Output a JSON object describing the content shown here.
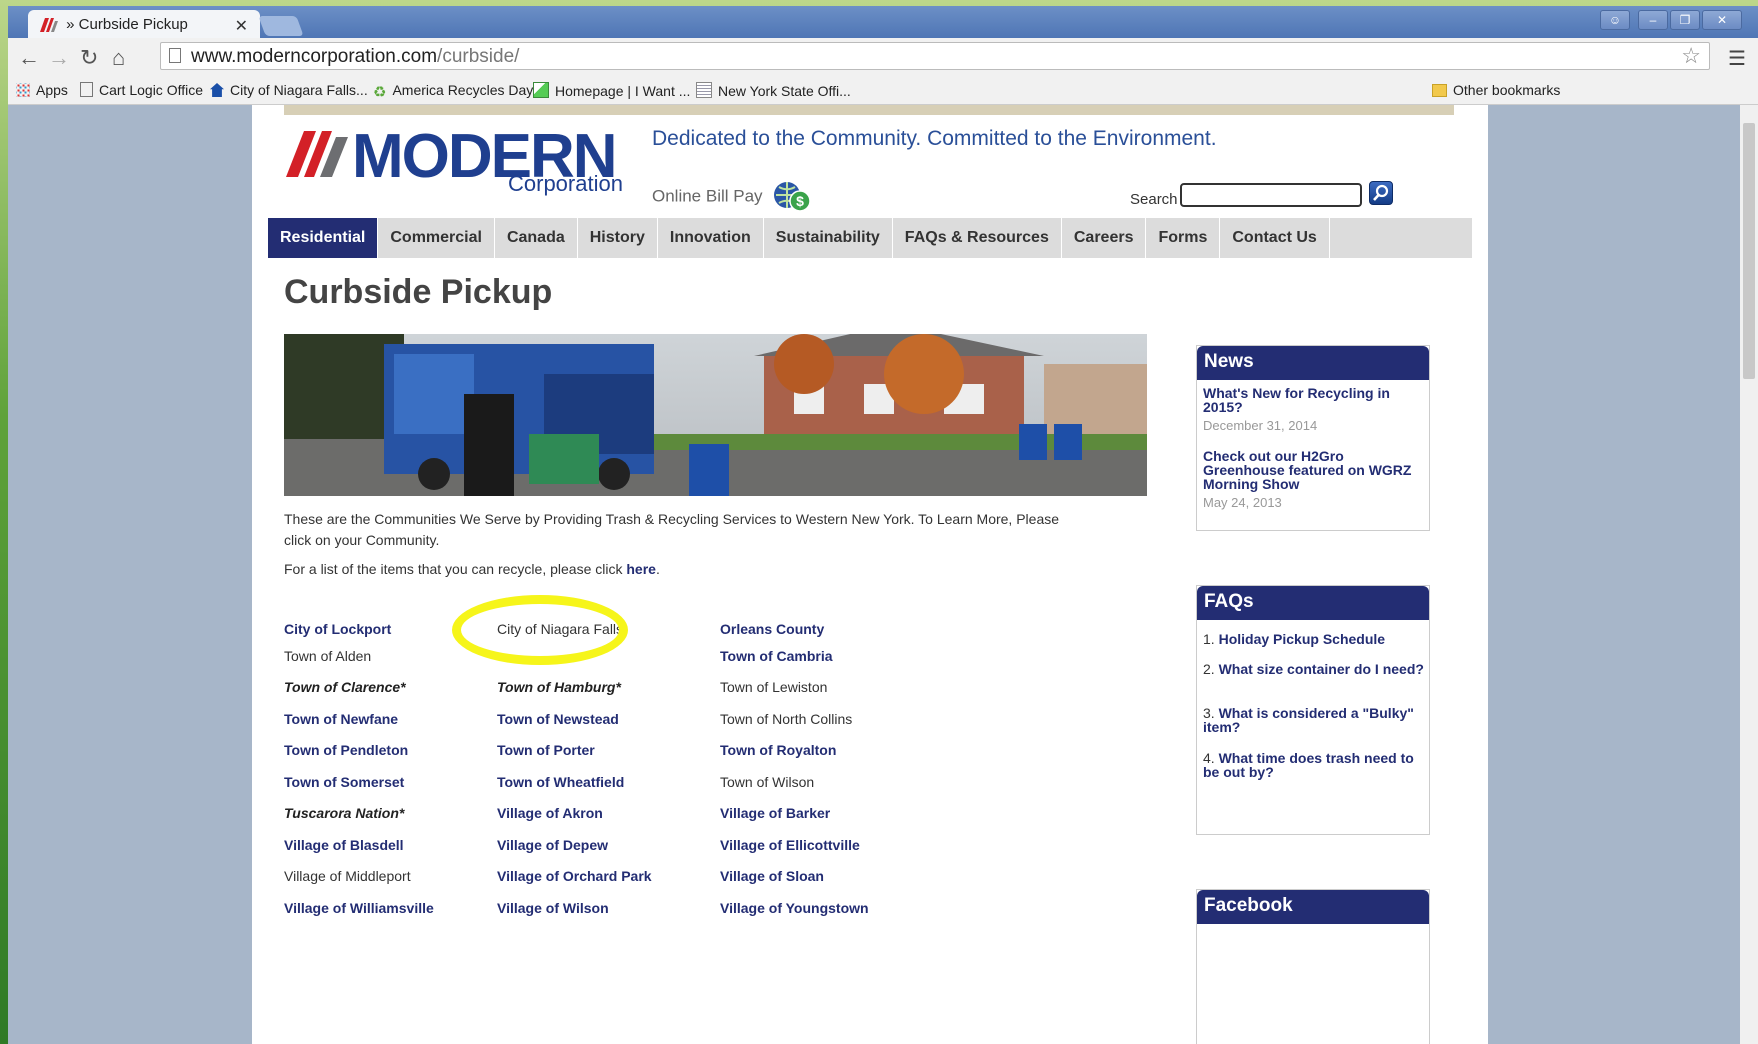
{
  "browser": {
    "tab_title": "» Curbside Pickup",
    "tab_close": "✕",
    "url_host": "www.moderncorporation.com",
    "url_path": "/curbside/",
    "bookmarks": [
      "Apps",
      "Cart Logic Office",
      "City of Niagara Falls...",
      "America Recycles Day",
      "Homepage | I Want ...",
      "New York State Offi..."
    ],
    "other_bookmarks": "Other bookmarks",
    "icons": [
      "back-icon",
      "forward-icon",
      "reload-icon",
      "home-icon",
      "star-icon",
      "menu-icon"
    ]
  },
  "header": {
    "logo_word": "MODERN",
    "logo_sub": "Corporation",
    "tagline": "Dedicated to the Community. Committed to the Environment.",
    "bill_pay": "Online Bill Pay",
    "search_label": "Search"
  },
  "nav": [
    "Residential",
    "Commercial",
    "Canada",
    "History",
    "Innovation",
    "Sustainability",
    "FAQs & Resources",
    "Careers",
    "Forms",
    "Contact Us"
  ],
  "main": {
    "title": "Curbside Pickup",
    "intro": "These are the Communities We Serve by Providing Trash & Recycling Services to Western New York. To Learn More, Please click on your Community.",
    "recycle_prefix": "For a list of the items that you can recycle, please click ",
    "recycle_link": "here",
    "recycle_suffix": "."
  },
  "communities": {
    "col1": [
      {
        "name": "City of Lockport",
        "style": "link"
      },
      {
        "name": "Town of Alden",
        "style": "plain"
      },
      {
        "name": "Town of Clarence*",
        "style": "italic"
      },
      {
        "name": "Town of Newfane",
        "style": "link"
      },
      {
        "name": "Town of Pendleton",
        "style": "link"
      },
      {
        "name": "Town of Somerset",
        "style": "link"
      },
      {
        "name": "Tuscarora Nation*",
        "style": "italic"
      },
      {
        "name": "Village of Blasdell",
        "style": "link"
      },
      {
        "name": "Village of Middleport",
        "style": "plain"
      },
      {
        "name": "Village of Williamsville",
        "style": "link"
      }
    ],
    "col2": [
      {
        "name": "City of Niagara Falls",
        "style": "plain"
      },
      {
        "name": "",
        "style": "plain"
      },
      {
        "name": "Town of Hamburg*",
        "style": "italic"
      },
      {
        "name": "Town of Newstead",
        "style": "link"
      },
      {
        "name": "Town of Porter",
        "style": "link"
      },
      {
        "name": "Town of Wheatfield",
        "style": "link"
      },
      {
        "name": "Village of Akron",
        "style": "link"
      },
      {
        "name": "Village of Depew",
        "style": "link"
      },
      {
        "name": "Village of Orchard Park",
        "style": "link"
      },
      {
        "name": "Village of Wilson",
        "style": "link"
      }
    ],
    "col3": [
      {
        "name": "Orleans County",
        "style": "link"
      },
      {
        "name": "Town of Cambria",
        "style": "link"
      },
      {
        "name": "Town of Lewiston",
        "style": "plain"
      },
      {
        "name": "Town of North Collins",
        "style": "plain"
      },
      {
        "name": "Town of Royalton",
        "style": "link"
      },
      {
        "name": "Town of Wilson",
        "style": "plain"
      },
      {
        "name": "Village of Barker",
        "style": "link"
      },
      {
        "name": "Village of Ellicottville",
        "style": "link"
      },
      {
        "name": "Village of Sloan",
        "style": "link"
      },
      {
        "name": "Village of Youngstown",
        "style": "link"
      }
    ]
  },
  "sidebar": {
    "news_heading": "News",
    "news": [
      {
        "title": "What's New for Recycling in 2015?",
        "date": "December 31, 2014"
      },
      {
        "title": "Check out our H2Gro Greenhouse featured on WGRZ Morning Show",
        "date": "May 24, 2013"
      }
    ],
    "faqs_heading": "FAQs",
    "faqs": [
      {
        "num": "1.",
        "text": "Holiday Pickup Schedule"
      },
      {
        "num": "2.",
        "text": "What size container do I need?"
      },
      {
        "num": "3.",
        "text": "What is considered a \"Bulky\" item?"
      },
      {
        "num": "4.",
        "text": "What time does trash need to be out by?"
      }
    ],
    "facebook_heading": "Facebook"
  },
  "colors": {
    "brand_navy": "#232d73",
    "logo_blue": "#1f3f8f",
    "logo_red": "#d32027",
    "highlight": "#f6f51a"
  }
}
